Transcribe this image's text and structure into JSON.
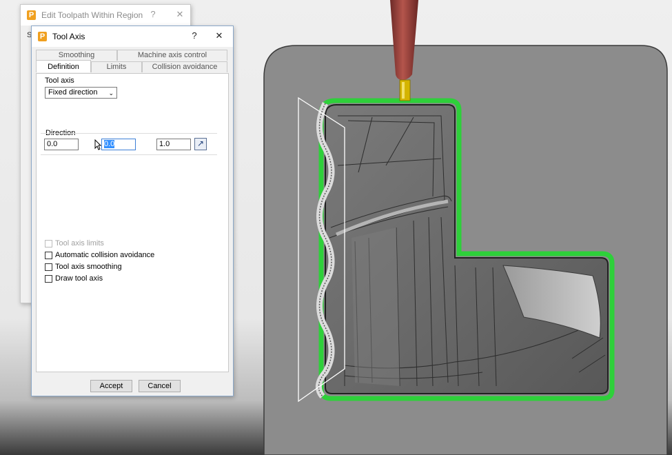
{
  "back_dialog": {
    "title": "Edit Toolpath Within Region",
    "help_glyph": "?",
    "close_glyph": "✕",
    "fragment": "S"
  },
  "dialog": {
    "title": "Tool Axis",
    "help_glyph": "?",
    "close_glyph": "✕",
    "tabs_top": [
      {
        "label": "Smoothing"
      },
      {
        "label": "Machine axis control"
      }
    ],
    "tabs_bottom": [
      {
        "label": "Definition",
        "active": true
      },
      {
        "label": "Limits"
      },
      {
        "label": "Collision avoidance"
      }
    ],
    "tool_axis_label": "Tool axis",
    "tool_axis_value": "Fixed direction",
    "direction_label": "Direction",
    "direction": {
      "x": "0.0",
      "y": "0.0",
      "z": "1.0"
    },
    "checkboxes": [
      {
        "label": "Tool axis limits",
        "checked": false,
        "disabled": true
      },
      {
        "label": "Automatic collision avoidance",
        "checked": false,
        "disabled": false
      },
      {
        "label": "Tool axis smoothing",
        "checked": false,
        "disabled": false
      },
      {
        "label": "Draw tool axis",
        "checked": false,
        "disabled": false
      }
    ],
    "accept_label": "Accept",
    "cancel_label": "Cancel"
  },
  "colors": {
    "accent_blue": "#3390ff",
    "tool_holder": "#a94a44",
    "tool_tip": "#d4b400",
    "boundary_green": "#2ed03a",
    "block_grey": "#8c8c8c",
    "cavity_grey": "#6e6e6e"
  }
}
